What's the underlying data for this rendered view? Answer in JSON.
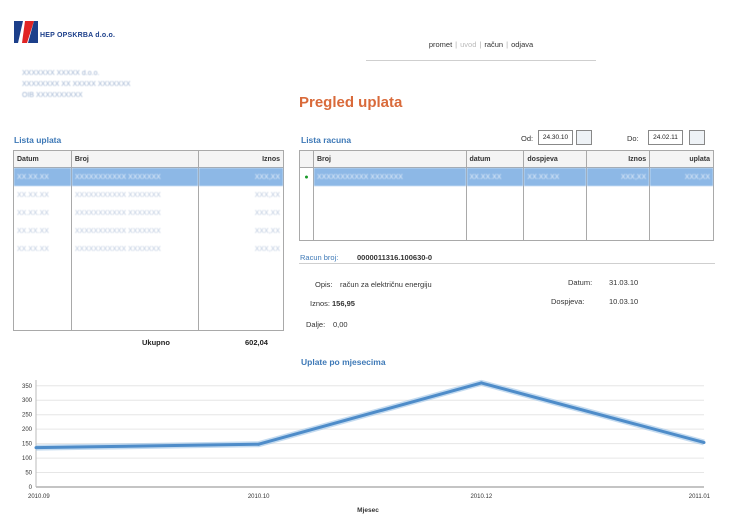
{
  "header": {
    "logo_text": "HEP OPSKRBA d.o.o.",
    "company_lines": [
      "XXXXXXX XXXXX d.o.o.",
      "XXXXXXXX XX XXXXX XXXXXXX",
      "OIB XXXXXXXXXX"
    ]
  },
  "nav": {
    "items": [
      {
        "label": "promet",
        "enabled": true
      },
      {
        "label": "uvod",
        "enabled": false
      },
      {
        "label": "račun",
        "enabled": true
      },
      {
        "label": "odjava",
        "enabled": true
      }
    ]
  },
  "page_title": "Pregled uplata",
  "filter": {
    "from_label": "Od:",
    "from_value": "24.30.10",
    "to_label": "Do:",
    "to_value": "24.02.11"
  },
  "payments": {
    "title": "Lista uplata",
    "columns": [
      "Datum",
      "Broj",
      "Iznos"
    ],
    "rows": [
      [
        "XX.XX.XX",
        "XXXXXXXXXXX XXXXXXX",
        "XXX,XX"
      ],
      [
        "XX.XX.XX",
        "XXXXXXXXXXX XXXXXXX",
        "XXX,XX"
      ],
      [
        "XX.XX.XX",
        "XXXXXXXXXXX XXXXXXX",
        "XXX,XX"
      ],
      [
        "XX.XX.XX",
        "XXXXXXXXXXX XXXXXXX",
        "XXX,XX"
      ],
      [
        "XX.XX.XX",
        "XXXXXXXXXXX XXXXXXX",
        "XXX,XX"
      ],
      [
        "",
        "",
        ""
      ],
      [
        "",
        "",
        ""
      ],
      [
        "",
        "",
        ""
      ],
      [
        "",
        "",
        ""
      ]
    ],
    "total_label": "Ukupno",
    "total_value": "602,04"
  },
  "invoices": {
    "title": "Lista racuna",
    "columns": [
      "",
      "Broj",
      "datum",
      "dospjeva",
      "Iznos",
      "uplata"
    ],
    "rows": [
      [
        "●",
        "XXXXXXXXXXX XXXXXXX",
        "XX.XX.XX",
        "XX.XX.XX",
        "XXX,XX",
        "XXX,XX"
      ],
      [
        "",
        "",
        "",
        "",
        "",
        ""
      ],
      [
        "",
        "",
        "",
        "",
        "",
        ""
      ],
      [
        "",
        "",
        "",
        "",
        "",
        ""
      ]
    ]
  },
  "invoice_detail": {
    "label": "Racun broj:",
    "number": "0000011316.100630-0",
    "opis_label": "Opis:",
    "opis_value": "račun za električnu energiju",
    "iznos_label": "Iznos:",
    "iznos_value": "156,95",
    "dalje_label": "Dalje:",
    "dalje_value": "0,00",
    "datum_label": "Datum:",
    "datum_value": "31.03.10",
    "dospjeva_label": "Dospjeva:",
    "dospjeva_value": "10.03.10"
  },
  "chart_data": {
    "type": "line",
    "title": "Uplate po mjesecima",
    "xlabel": "Mjesec",
    "ylabel": "",
    "categories": [
      "2010.09",
      "2010.10",
      "2010.12",
      "2011.01"
    ],
    "values": [
      136,
      148,
      360,
      154
    ],
    "y_ticks": [
      0,
      50,
      100,
      150,
      200,
      250,
      300,
      350
    ],
    "ylim": [
      0,
      370
    ],
    "grid": true,
    "color": "#4e8cc9"
  }
}
